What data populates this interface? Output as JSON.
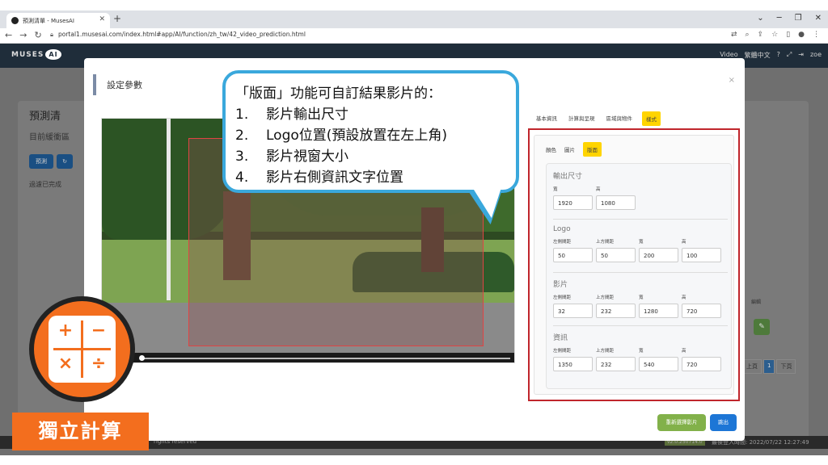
{
  "browser": {
    "tab_title": "預測清單 - MusesAI",
    "new_tab": "+",
    "url": "portal1.musesai.com/index.html#app/AI/function/zh_tw/42_video_prediction.html"
  },
  "app_header": {
    "logo_text": "MUSES",
    "logo_ai": "AI",
    "menu_video": "Video",
    "menu_language": "繁體中文",
    "user": "zoe"
  },
  "background_page": {
    "title": "預測清",
    "subtitle": "目前緩衝區",
    "predict_btn": "預測",
    "filter_done": "過濾已完成",
    "table_edit": "編輯",
    "pagination": [
      "上頁",
      "1",
      "下頁"
    ],
    "footer_left": "rights reserved",
    "footer_version": "v2.0.250714.0",
    "footer_right": "最後登入時間: 2022/07/22 12:27:49"
  },
  "modal": {
    "title": "設定參數",
    "close": "×",
    "top_tabs": [
      "基本資訊",
      "計算與呈現",
      "區域與物件",
      "樣式"
    ],
    "active_top_tab": "樣式",
    "sub_tabs": [
      "顏色",
      "圖片",
      "版面"
    ],
    "active_sub_tab": "版面",
    "layout": {
      "output_size": {
        "title": "輸出尺寸",
        "labels": [
          "寬",
          "高"
        ],
        "values": [
          "1920",
          "1080"
        ]
      },
      "logo": {
        "title": "Logo",
        "labels": [
          "左側間距",
          "上方間距",
          "寬",
          "高"
        ],
        "values": [
          "50",
          "50",
          "200",
          "100"
        ]
      },
      "video": {
        "title": "影片",
        "labels": [
          "左側間距",
          "上方間距",
          "寬",
          "高"
        ],
        "values": [
          "32",
          "232",
          "1280",
          "720"
        ]
      },
      "info": {
        "title": "資訊",
        "labels": [
          "左側間距",
          "上方間距",
          "寬",
          "高"
        ],
        "values": [
          "1350",
          "232",
          "540",
          "720"
        ]
      }
    },
    "reselect_btn": "重新選擇影片",
    "exit_btn": "跳出"
  },
  "callout": {
    "title": "「版面」功能可自訂結果影片的：",
    "items": [
      {
        "num": "1.",
        "text": "影片輸出尺寸"
      },
      {
        "num": "2.",
        "text": "Logo位置(預設放置在左上角)"
      },
      {
        "num": "3.",
        "text": "影片視窗大小"
      },
      {
        "num": "4.",
        "text": "影片右側資訊文字位置"
      }
    ]
  },
  "badge": {
    "label": "獨立計算",
    "glyphs": [
      "+",
      "−",
      "×",
      "÷"
    ]
  },
  "colors": {
    "accent_orange": "#f36e1e",
    "callout_blue": "#3aa8dc",
    "highlight_red": "#c0262c",
    "tab_yellow": "#ffd400"
  }
}
